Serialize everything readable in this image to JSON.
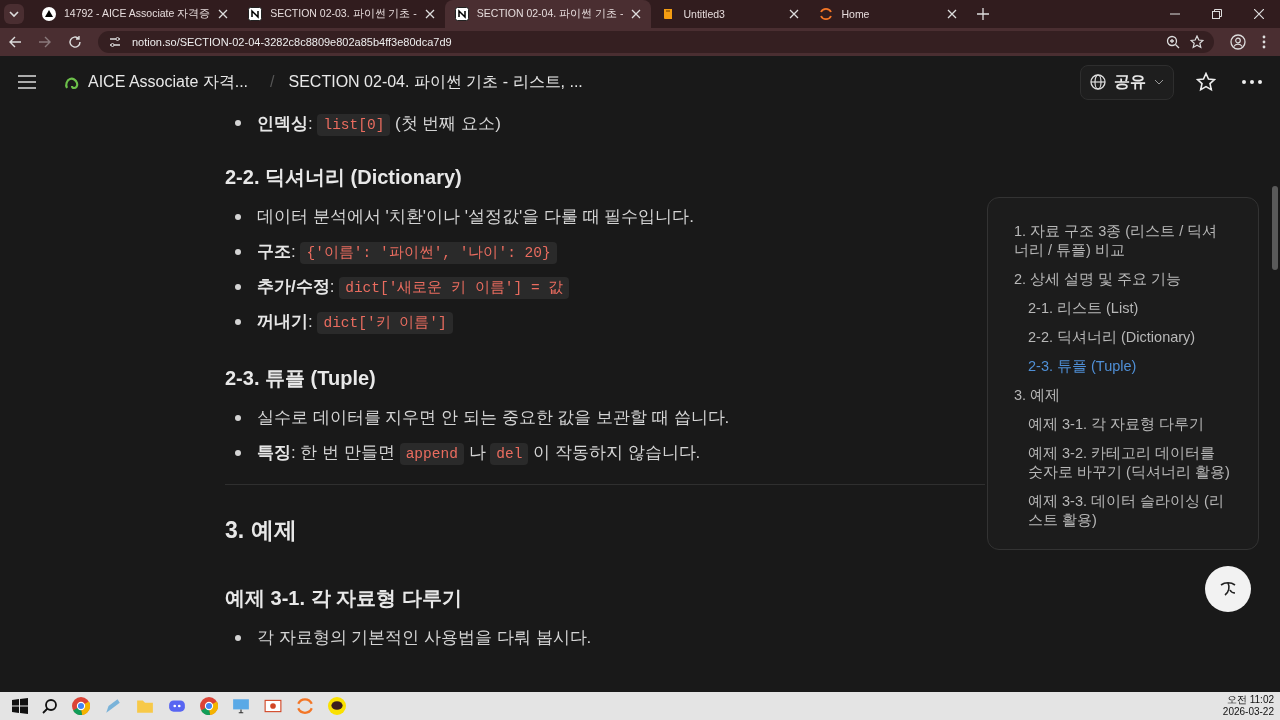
{
  "browser": {
    "tabs": [
      {
        "title": "14792 - AICE Associate 자격증",
        "selected": false,
        "kind": "triangle"
      },
      {
        "title": "SECTION 02-03. 파이썬 기초 -",
        "selected": false,
        "kind": "notion"
      },
      {
        "title": "SECTION 02-04. 파이썬 기초 -",
        "selected": true,
        "kind": "notion"
      },
      {
        "title": "Untitled3",
        "selected": false,
        "kind": "book"
      },
      {
        "title": "Home",
        "selected": false,
        "kind": "ring"
      }
    ],
    "url": "notion.so/SECTION-02-04-3282c8c8809e802a85b4ff3e80dca7d9"
  },
  "header": {
    "workspace": "AICE Associate 자격...",
    "separator": "/",
    "page_title": "SECTION 02-04. 파이썬 기초 - 리스트, ...",
    "share": "공유"
  },
  "blocks": [
    {
      "kind": "bullet",
      "segments": [
        {
          "kind": "bold",
          "text": "인덱싱"
        },
        {
          "kind": "text",
          "text": ": "
        },
        {
          "kind": "code",
          "text": "list[0]"
        },
        {
          "kind": "text",
          "text": " (첫 번째 요소)"
        }
      ]
    },
    {
      "kind": "heading3",
      "text": "2-2. 딕셔너리 (Dictionary)"
    },
    {
      "kind": "bullet",
      "segments": [
        {
          "kind": "text",
          "text": "데이터 분석에서 '치환'이나 '설정값'을 다룰 때 필수입니다."
        }
      ]
    },
    {
      "kind": "bullet",
      "segments": [
        {
          "kind": "bold",
          "text": "구조"
        },
        {
          "kind": "text",
          "text": ": "
        },
        {
          "kind": "code",
          "text": "{'이름': '파이썬', '나이': 20}"
        }
      ]
    },
    {
      "kind": "bullet",
      "segments": [
        {
          "kind": "bold",
          "text": "추가/수정"
        },
        {
          "kind": "text",
          "text": ": "
        },
        {
          "kind": "code",
          "text": "dict['새로운 키 이름'] = 값"
        }
      ]
    },
    {
      "kind": "bullet",
      "segments": [
        {
          "kind": "bold",
          "text": "꺼내기"
        },
        {
          "kind": "text",
          "text": ": "
        },
        {
          "kind": "code",
          "text": "dict['키 이름']"
        }
      ]
    },
    {
      "kind": "heading3",
      "text": "2-3. 튜플 (Tuple)"
    },
    {
      "kind": "bullet",
      "segments": [
        {
          "kind": "text",
          "text": "실수로 데이터를 지우면 안 되는 중요한 값을 보관할 때 씁니다."
        }
      ]
    },
    {
      "kind": "bullet",
      "segments": [
        {
          "kind": "bold",
          "text": "특징"
        },
        {
          "kind": "text",
          "text": ": 한 번 만들면 "
        },
        {
          "kind": "code",
          "text": "append"
        },
        {
          "kind": "text",
          "text": " 나 "
        },
        {
          "kind": "code",
          "text": "del"
        },
        {
          "kind": "text",
          "text": " 이 작동하지 않습니다."
        }
      ]
    },
    {
      "kind": "divider"
    },
    {
      "kind": "heading2",
      "text": "3. 예제"
    },
    {
      "kind": "heading3",
      "text": "예제 3-1. 각 자료형 다루기"
    },
    {
      "kind": "bullet",
      "segments": [
        {
          "kind": "text",
          "text": "각 자료형의 기본적인 사용법을 다뤄 봅시다."
        }
      ]
    }
  ],
  "toc": [
    {
      "text": "1. 자료 구조 3종 (리스트 / 딕셔너리 / 튜플) 비교",
      "selected": false
    },
    {
      "text": "2. 상세 설명 및 주요 기능",
      "selected": false,
      "children": [
        {
          "text": "2-1. 리스트 (List)",
          "selected": false
        },
        {
          "text": "2-2. 딕셔너리 (Dictionary)",
          "selected": false
        },
        {
          "text": "2-3. 튜플 (Tuple)",
          "selected": true
        }
      ]
    },
    {
      "text": "3. 예제",
      "selected": false,
      "children": [
        {
          "text": "예제 3-1. 각 자료형 다루기",
          "selected": false
        },
        {
          "text": "예제 3-2. 카테고리 데이터를 숫자로 바꾸기 (딕셔너리 활용)",
          "selected": false
        },
        {
          "text": "예제 3-3. 데이터 슬라이싱 (리스트 활용)",
          "selected": false
        }
      ]
    }
  ],
  "clock": {
    "time": "오전 11:02",
    "date": "2026-03-22"
  }
}
